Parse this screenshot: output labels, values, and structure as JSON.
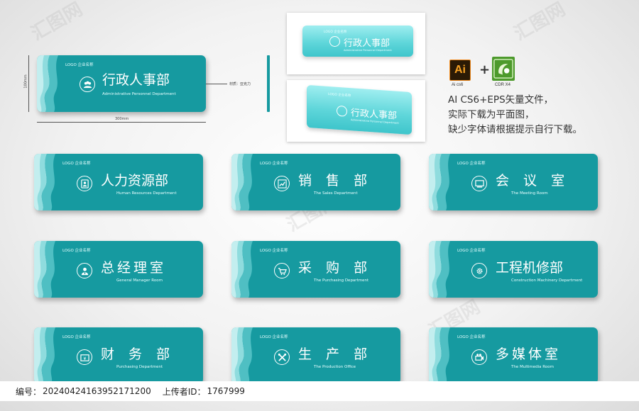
{
  "big_sign": {
    "logo": "LOGO 企业名称",
    "cn": "行政人事部",
    "en": "Administrative Personnel Department",
    "dim_height": "100mm",
    "dim_width": "300mm",
    "material": "材质：亚克力"
  },
  "mockups": [
    {
      "logo": "LOGO 企业名称",
      "cn": "行政人事部",
      "en": "Administrative Personnel Department"
    },
    {
      "logo": "LOGO 企业名称",
      "cn": "行政人事部",
      "en": "Administrative Personnel Department"
    }
  ],
  "software": {
    "ai_label": "Ai",
    "ai_caption": "Ai cs6",
    "plus": "+",
    "cdr_caption": "CDR X4"
  },
  "info_lines": [
    "AI CS6+EPS矢量文件，",
    "实际下载为平面图，",
    "缺少字体请根据提示自行下载。"
  ],
  "signs": [
    {
      "logo": "LOGO 企业名称",
      "cn": "人力资源部",
      "en": "Human Resources Department",
      "icon": "id-card-icon",
      "spacing": "normal"
    },
    {
      "logo": "LOGO 企业名称",
      "cn": "销 售 部",
      "en": "The Sales Department",
      "icon": "chart-icon",
      "spacing": "wide"
    },
    {
      "logo": "LOGO 企业名称",
      "cn": "会 议 室",
      "en": "The Meeting Room",
      "icon": "screen-icon",
      "spacing": "wide"
    },
    {
      "logo": "LOGO 企业名称",
      "cn": "总经理室",
      "en": "General Manager Room",
      "icon": "manager-icon",
      "spacing": "mid"
    },
    {
      "logo": "LOGO 企业名称",
      "cn": "采 购 部",
      "en": "The Purchasing Department",
      "icon": "cart-icon",
      "spacing": "wide"
    },
    {
      "logo": "LOGO 企业名称",
      "cn": "工程机修部",
      "en": "Construction Machinery Department",
      "icon": "gear-icon",
      "spacing": "normal"
    },
    {
      "logo": "LOGO 企业名称",
      "cn": "财 务 部",
      "en": "Purchasing Department",
      "icon": "finance-icon",
      "spacing": "wide"
    },
    {
      "logo": "LOGO 企业名称",
      "cn": "生 产 部",
      "en": "The Production Office",
      "icon": "tools-icon",
      "spacing": "wide"
    },
    {
      "logo": "LOGO 企业名称",
      "cn": "多媒体室",
      "en": "The Multimedia Room",
      "icon": "projector-icon",
      "spacing": "mid"
    }
  ],
  "footer": {
    "id_label": "编号：",
    "id_value": "20240424163952171200",
    "uploader_label": "上传者ID：",
    "uploader_value": "1767999"
  },
  "watermark": "汇图网",
  "colors": {
    "sign_bg": "#169aa0",
    "wave_light": "#7fd6d8",
    "wave_mid": "#43b8bd"
  }
}
